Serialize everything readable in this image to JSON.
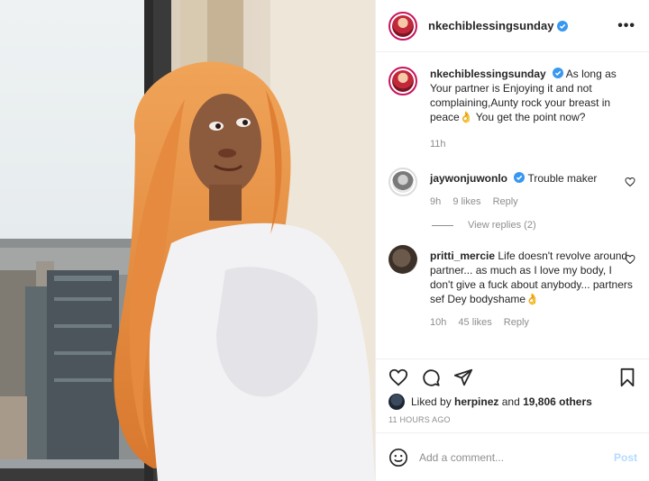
{
  "post": {
    "username": "nkechiblessingsunday",
    "more_label": "•••"
  },
  "caption": {
    "username": "nkechiblessingsunday",
    "text": "As long as Your partner is Enjoying it and not complaining,Aunty rock your breast in peace👌 You get the point now?",
    "time": "11h"
  },
  "comments": [
    {
      "username": "jaywonjuwonlo",
      "text": "Trouble maker",
      "time": "9h",
      "likes": "9 likes",
      "reply": "Reply",
      "view_replies": "View replies (2)"
    },
    {
      "username": "pritti_mercie",
      "text": "Life doesn't revolve around partner... as much as I love my body, I don't give a fuck about anybody... partners sef Dey bodyshame👌",
      "time": "10h",
      "likes": "45 likes",
      "reply": "Reply"
    }
  ],
  "likes": {
    "prefix": "Liked by",
    "user": "herpinez",
    "joiner": "and",
    "others": "19,806 others"
  },
  "posted_ago": "11 HOURS AGO",
  "add_comment": {
    "placeholder": "Add a comment...",
    "post_label": "Post"
  },
  "colors": {
    "verified": "#3897f0",
    "story_ring": "#c8135e",
    "post_disabled": "#b3dbff",
    "hair": "#e88a3c",
    "shirt": "#f2f2f4"
  },
  "icons": [
    "verified-icon",
    "more-icon",
    "heart-icon",
    "comment-icon",
    "share-icon",
    "bookmark-icon",
    "emoji-icon"
  ]
}
